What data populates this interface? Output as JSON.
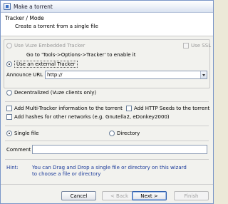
{
  "window": {
    "title": "Make a torrent"
  },
  "header": {
    "title": "Tracker / Mode",
    "subtitle": "Create a torrent from a single file"
  },
  "tracker": {
    "embedded_label": "Use Vuze Embedded Tracker",
    "use_ssl_label": "Use SSL",
    "embedded_hint": "Go to 'Tools->Options->Tracker' to enable it",
    "external_label": "Use an external Tracker",
    "announce_label": "Announce URL :",
    "announce_value": "http://",
    "decentralized_label": "Decentralized (Vuze clients only)"
  },
  "options": {
    "multi_tracker_label": "Add Multi-Tracker information to the torrent",
    "http_seeds_label": "Add HTTP Seeds to the torrent",
    "hashes_label": "Add hashes for other networks (e.g. Gnutella2, eDonkey2000)"
  },
  "mode": {
    "single_file_label": "Single file",
    "directory_label": "Directory"
  },
  "comment": {
    "label": "Comment",
    "value": ""
  },
  "hint": {
    "label": "Hint:",
    "text": "You can Drag and Drop a single file or directory on this wizard to choose a file or directory"
  },
  "buttons": {
    "cancel": "Cancel",
    "back": "< Back",
    "next": "Next >",
    "finish": "Finish"
  }
}
